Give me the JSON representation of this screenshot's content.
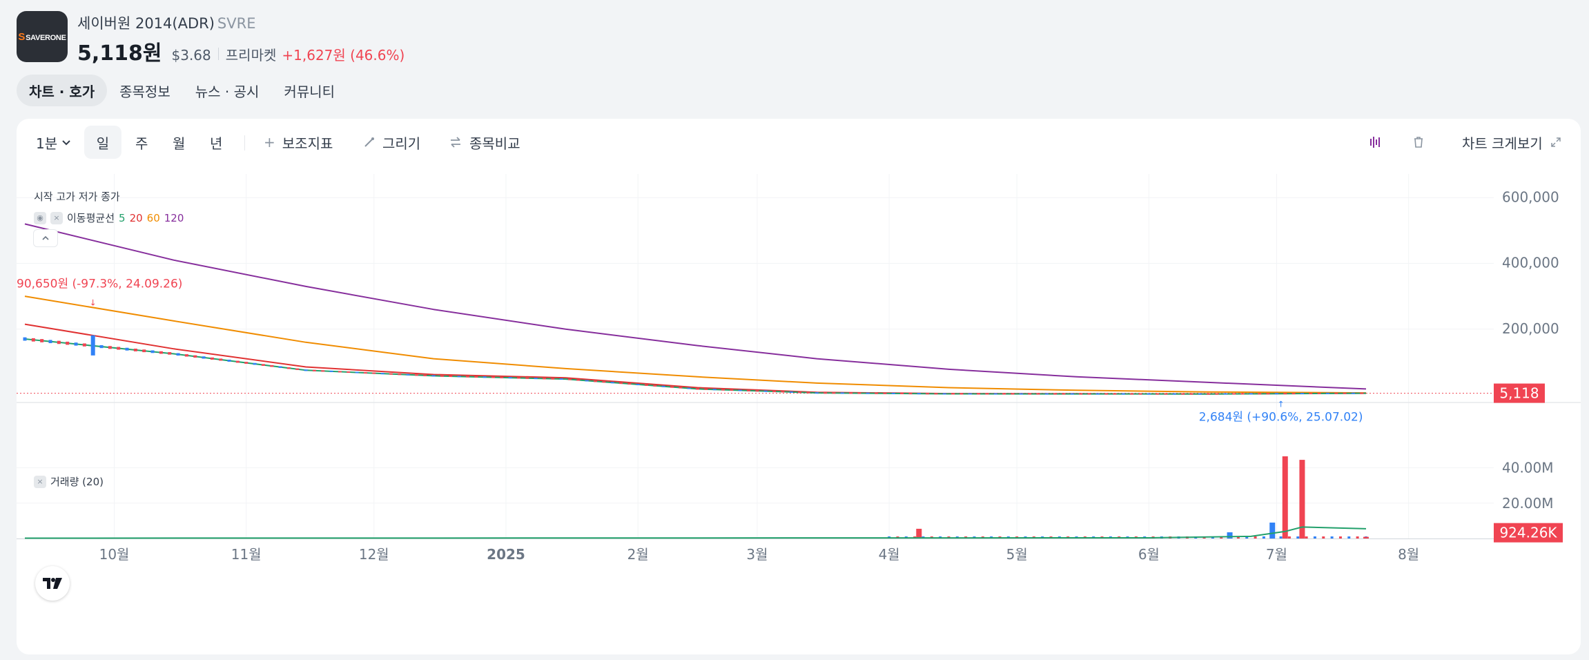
{
  "header": {
    "logo_text": "SAVERONE",
    "logo_letter": "S",
    "name": "세이버원 2014(ADR)",
    "ticker": "SVRE",
    "price": "5,118원",
    "price_usd": "$3.68",
    "session": "프리마켓",
    "change": "+1,627원 (46.6%)"
  },
  "tabs": [
    "차트 · 호가",
    "종목정보",
    "뉴스 · 공시",
    "커뮤니티"
  ],
  "toolbar": {
    "interval": "1분",
    "periods": [
      "일",
      "주",
      "월",
      "년"
    ],
    "indicators": "보조지표",
    "draw": "그리기",
    "compare": "종목비교",
    "expand": "차트 크게보기"
  },
  "legend": {
    "ohlc": "시작 고가 저가 종가",
    "ma_label": "이동평균선",
    "ma_periods": [
      "5",
      "20",
      "60",
      "120"
    ],
    "volume": "거래량 (20)"
  },
  "colors": {
    "up": "#f04452",
    "down": "#3182f6",
    "ma5": "#22a06b",
    "ma20": "#e03131",
    "ma60": "#f08c00",
    "ma120": "#862e9c"
  },
  "chart_data": {
    "type": "line",
    "x_labels": [
      "10월",
      "11월",
      "12월",
      "2025",
      "2월",
      "3월",
      "4월",
      "5월",
      "6월",
      "7월",
      "8월"
    ],
    "price_axis": [
      "600,000",
      "400,000",
      "200,000"
    ],
    "price_ylim": [
      0,
      630000
    ],
    "current_price_label": "5,118",
    "annotation_high": "90,650원 (-97.3%, 24.09.26)",
    "annotation_low": "2,684원 (+90.6%, 25.07.02)",
    "volume_axis": [
      "40.00M",
      "20.00M"
    ],
    "volume_ylim": [
      0,
      50000000
    ],
    "current_volume_label": "924.26K",
    "ma_series": [
      {
        "name": "120",
        "x": [
          "24.09.10",
          "24.10.15",
          "24.11.15",
          "24.12.15",
          "25.01.15",
          "25.02.15",
          "25.03.15",
          "25.04.15",
          "25.05.15",
          "25.06.15",
          "25.07.22"
        ],
        "values": [
          520000,
          410000,
          330000,
          260000,
          200000,
          150000,
          110000,
          78000,
          55000,
          38000,
          18000
        ]
      },
      {
        "name": "60",
        "x": [
          "24.09.10",
          "24.10.15",
          "24.11.15",
          "24.12.15",
          "25.01.15",
          "25.02.15",
          "25.03.15",
          "25.04.15",
          "25.05.15",
          "25.06.15",
          "25.07.22"
        ],
        "values": [
          300000,
          225000,
          160000,
          110000,
          80000,
          55000,
          36000,
          22000,
          14000,
          9000,
          6000
        ]
      },
      {
        "name": "20",
        "x": [
          "24.09.10",
          "24.10.15",
          "24.11.15",
          "24.12.15",
          "25.01.15",
          "25.02.15",
          "25.03.15",
          "25.04.15",
          "25.05.15",
          "25.06.15",
          "25.07.22"
        ],
        "values": [
          215000,
          140000,
          85000,
          62000,
          52000,
          22000,
          8000,
          4000,
          3500,
          3000,
          5000
        ]
      },
      {
        "name": "5",
        "x": [
          "24.09.10",
          "24.10.15",
          "24.11.15",
          "24.12.15",
          "25.01.15",
          "25.02.15",
          "25.03.15",
          "25.04.15",
          "25.05.15",
          "25.06.15",
          "25.07.22"
        ],
        "values": [
          170000,
          125000,
          75000,
          58000,
          48000,
          18000,
          6000,
          3200,
          3000,
          2800,
          5000
        ]
      }
    ],
    "volume_spikes": [
      {
        "date": "25.04.08",
        "value": 5500000,
        "dir": "up"
      },
      {
        "date": "25.06.20",
        "value": 3500000,
        "dir": "down"
      },
      {
        "date": "25.06.30",
        "value": 9000000,
        "dir": "down"
      },
      {
        "date": "25.07.03",
        "value": 46500000,
        "dir": "up"
      },
      {
        "date": "25.07.07",
        "value": 44500000,
        "dir": "up"
      },
      {
        "date": "25.07.22",
        "value": 924260,
        "dir": "up"
      }
    ]
  }
}
